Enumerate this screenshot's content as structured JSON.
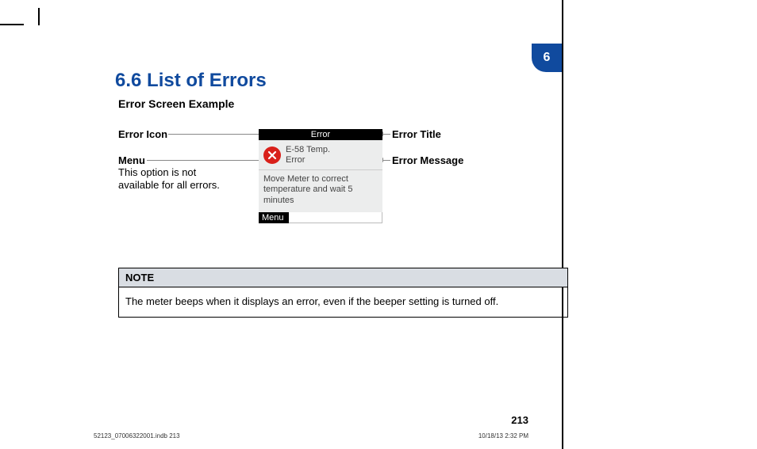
{
  "chapter_tab": "6",
  "heading": "6.6 List of Errors",
  "subheading": "Error Screen Example",
  "callouts": {
    "error_icon": "Error Icon",
    "menu": "Menu",
    "menu_note": "This option is not available for all errors.",
    "error_title": "Error Title",
    "error_message": "Error Message"
  },
  "device": {
    "titlebar": "Error",
    "error_line1": "E-58 Temp.",
    "error_line2": "Error",
    "body": "Move Meter to correct temperature and wait 5 minutes",
    "menu": "Menu"
  },
  "note": {
    "label": "NOTE",
    "body": "The meter beeps when it displays an error, even if the beeper setting is turned off."
  },
  "page_number": "213",
  "footer_left": "52123_07006322001.indb   213",
  "footer_right": "10/18/13   2:32 PM"
}
